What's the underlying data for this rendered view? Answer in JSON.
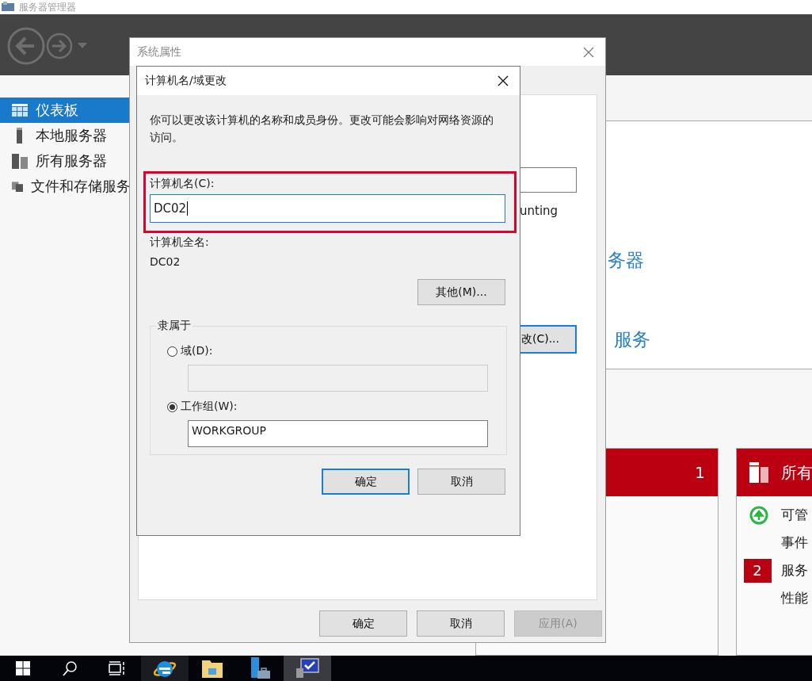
{
  "server_manager": {
    "title": "服务器管理器",
    "sidebar": [
      {
        "label": "仪表板",
        "selected": true,
        "kind": "dashboard"
      },
      {
        "label": "本地服务器",
        "selected": false,
        "kind": "server"
      },
      {
        "label": "所有服务器",
        "selected": false,
        "kind": "servers"
      },
      {
        "label": "文件和存储服务",
        "selected": false,
        "kind": "files"
      }
    ],
    "headings": [
      "务器",
      "服务"
    ],
    "tiles": [
      {
        "kind": "count",
        "count": "1"
      },
      {
        "kind": "group",
        "title": "所有",
        "items": [
          {
            "label": "可管",
            "kind": "ok"
          },
          {
            "label": "事件",
            "kind": "plain"
          },
          {
            "label": "服务",
            "kind": "badge",
            "badge": "2"
          },
          {
            "label": "性能",
            "kind": "plain"
          }
        ]
      }
    ]
  },
  "system_properties": {
    "title": "系统属性",
    "partial_text": "unting",
    "partial_button": "改(C)...",
    "buttons": [
      {
        "label": "确定",
        "disabled": false
      },
      {
        "label": "取消",
        "disabled": false
      },
      {
        "label": "应用(A)",
        "disabled": true
      }
    ]
  },
  "change_dialog": {
    "title": "计算机名/域更改",
    "description": "你可以更改该计算机的名称和成员身份。更改可能会影响对网络资源的访问。",
    "name_label": "计算机名(C):",
    "name_value": "DC02",
    "full_name_label": "计算机全名:",
    "full_name": "DC02",
    "more_button": "其他(M)...",
    "member_of": {
      "title": "隶属于",
      "options": [
        {
          "label": "域(D):",
          "selected": false,
          "value_disabled": true
        },
        {
          "label": "工作组(W):",
          "selected": true,
          "value": "WORKGROUP",
          "value_disabled": false
        }
      ]
    },
    "buttons": [
      {
        "label": "确定",
        "default": true
      },
      {
        "label": "取消",
        "default": false
      }
    ]
  },
  "taskbar": {
    "apps": [
      {
        "kind": "start",
        "selected": false
      },
      {
        "kind": "search",
        "selected": false
      },
      {
        "kind": "taskview",
        "selected": false
      },
      {
        "kind": "browser",
        "selected": true
      },
      {
        "kind": "folder",
        "selected": false
      },
      {
        "kind": "server-manager",
        "selected": false
      },
      {
        "kind": "remote",
        "selected": true
      }
    ]
  }
}
